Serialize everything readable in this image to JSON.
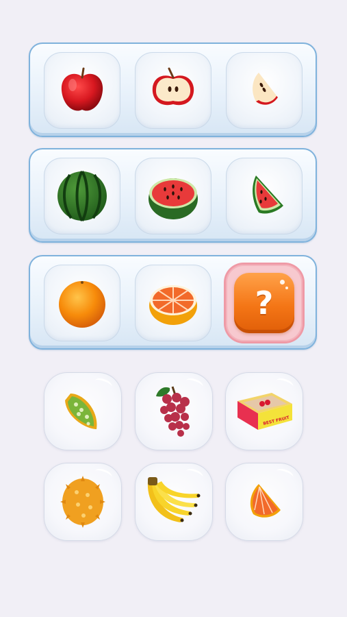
{
  "board": {
    "rows": [
      {
        "items": [
          "apple-whole-icon",
          "apple-half-icon",
          "apple-slice-icon"
        ]
      },
      {
        "items": [
          "watermelon-whole-icon",
          "watermelon-half-icon",
          "watermelon-slice-icon"
        ]
      },
      {
        "items": [
          "orange-whole-icon",
          "orange-half-icon",
          "mystery-hint-button"
        ]
      }
    ],
    "hint_symbol": "?"
  },
  "tray": {
    "items": [
      "kiwano-slice-icon",
      "grapes-icon",
      "fruit-box-icon",
      "kiwano-whole-icon",
      "bananas-icon",
      "orange-slice-icon"
    ],
    "box_text": "BEST FRUIT"
  },
  "colors": {
    "board_border": "#7fb2dc",
    "hint_button": "#f47616",
    "hint_glow": "#ef9aa6",
    "background": "#f1eff6"
  }
}
